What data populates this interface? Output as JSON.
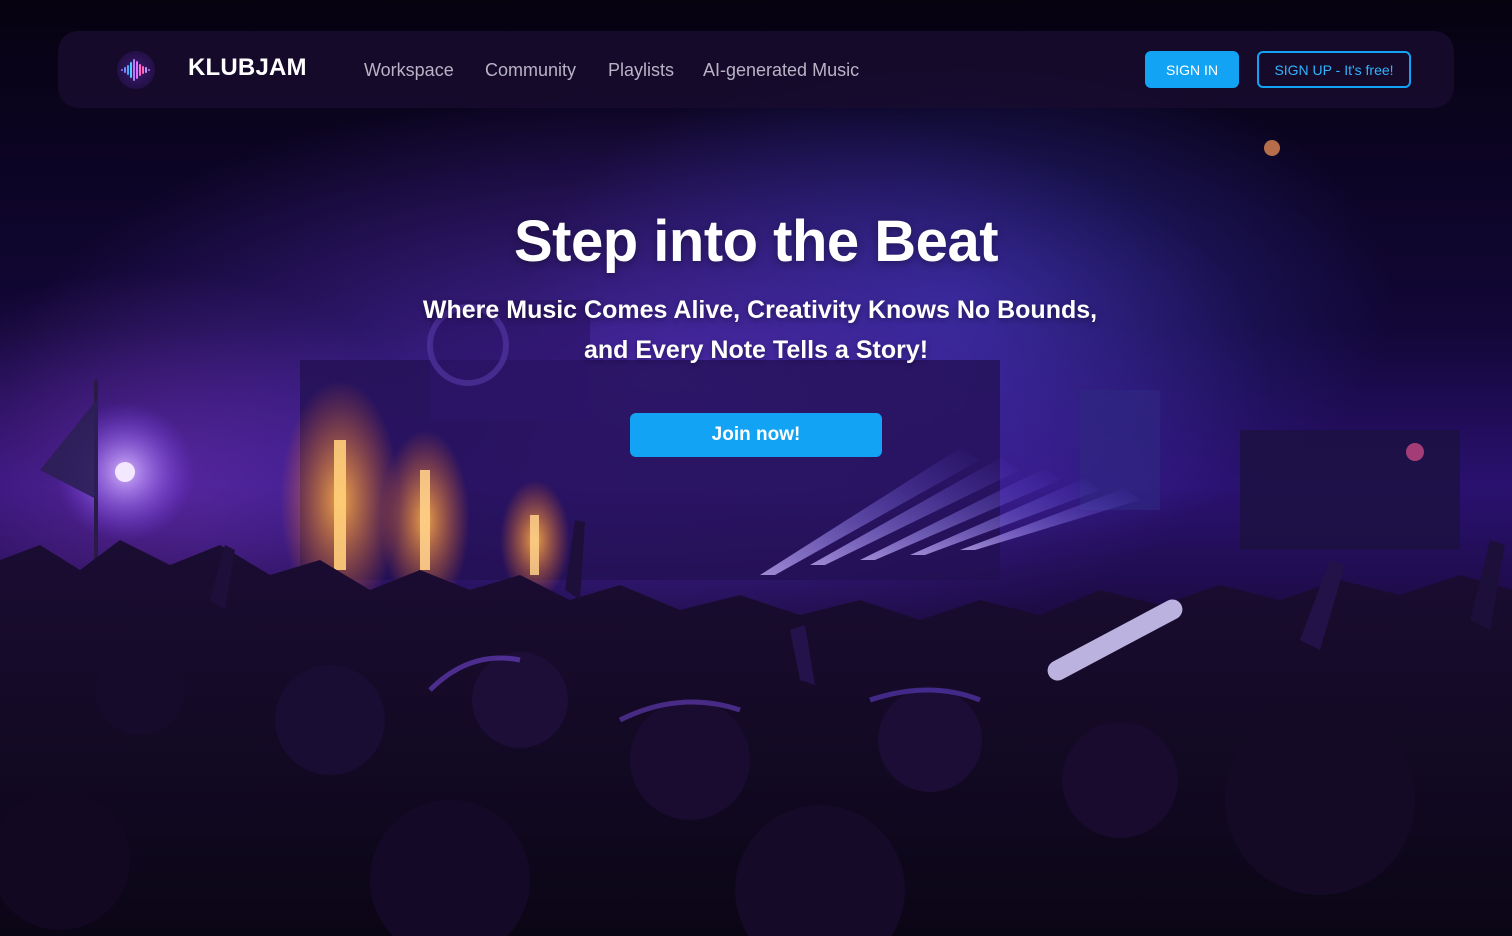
{
  "brand": {
    "name": "KLUBJAM",
    "logo_icon": "soundwave-logo-icon"
  },
  "nav": {
    "links": [
      "Workspace",
      "Community",
      "Playlists",
      "AI-generated Music"
    ]
  },
  "auth": {
    "sign_in_label": "SIGN IN",
    "sign_up_label": "SIGN UP - It's free!"
  },
  "hero": {
    "title": "Step into the Beat",
    "subtitle_line1": "Where Music Comes Alive, Creativity Knows No Bounds,",
    "subtitle_line2": "and Every Note Tells a Story!",
    "cta_label": "Join now!",
    "background": "concert-crowd-image"
  },
  "colors": {
    "accent": "#12a3f5",
    "navbar": "#180c2e",
    "text": "#ffffff",
    "nav_link": "#b8b3c7",
    "stage_glow": "#6a3ce6",
    "flame": "#ff8a2a"
  }
}
